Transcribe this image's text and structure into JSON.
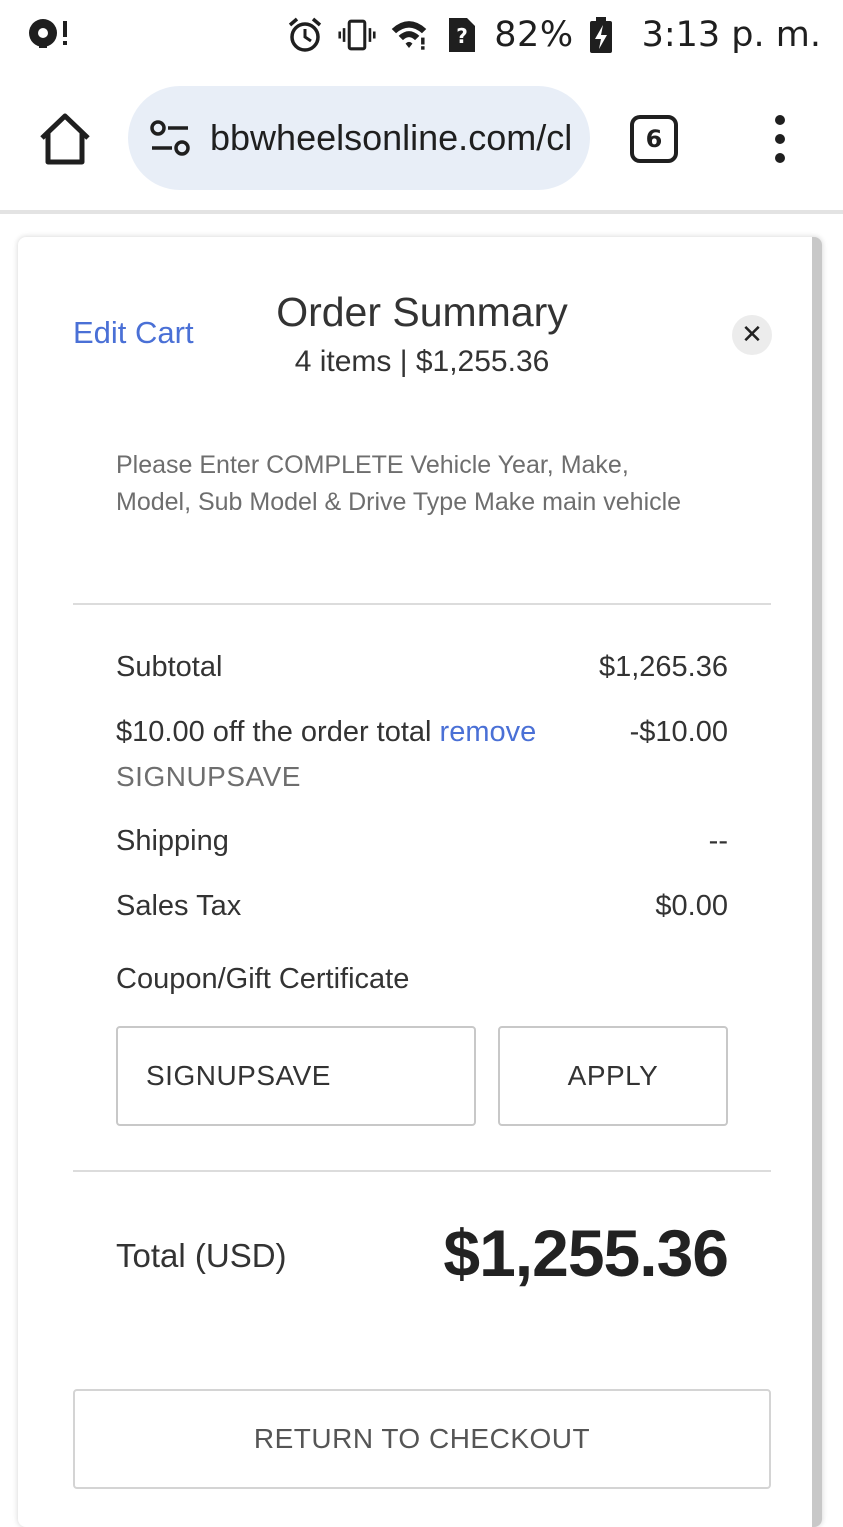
{
  "status_bar": {
    "notification_icon": "podcast-icon",
    "icons": [
      "alarm-icon",
      "vibrate-icon",
      "wifi-icon",
      "no-sim-icon"
    ],
    "battery_percent": "82%",
    "battery_icon": "battery-charging-icon",
    "time": "3:13 p. m."
  },
  "browser": {
    "url": "bbwheelsonline.com/cl",
    "tab_count": "6"
  },
  "order_summary": {
    "edit_cart_label": "Edit Cart",
    "title": "Order Summary",
    "subtitle": "4 items | $1,255.36",
    "vehicle_note": "Please Enter COMPLETE Vehicle Year, Make, Model, Sub Model & Drive Type Make main vehicle",
    "subtotal_label": "Subtotal",
    "subtotal_value": "$1,265.36",
    "discount_label": "$10.00 off the order total",
    "remove_label": "remove",
    "discount_value": "-$10.00",
    "discount_code": "SIGNUPSAVE",
    "shipping_label": "Shipping",
    "shipping_value": "--",
    "tax_label": "Sales Tax",
    "tax_value": "$0.00",
    "coupon_label": "Coupon/Gift Certificate",
    "coupon_value": "SIGNUPSAVE",
    "apply_label": "APPLY",
    "total_label": "Total (USD)",
    "total_value": "$1,255.36",
    "return_label": "RETURN TO CHECKOUT"
  },
  "colors": {
    "link": "#4a70d6",
    "url_pill": "#e8eef7"
  }
}
